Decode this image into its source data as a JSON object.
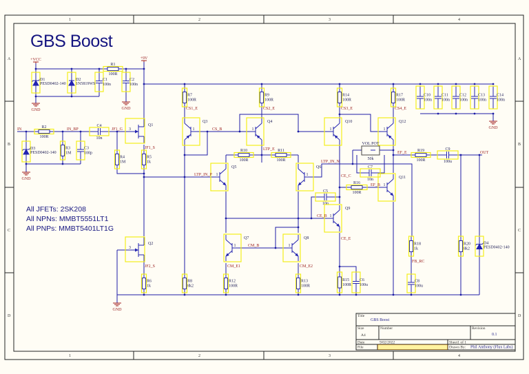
{
  "sheet": {
    "title": "GBS Boost",
    "columns": [
      "1",
      "2",
      "3",
      "4"
    ],
    "rows": [
      "A",
      "B",
      "C",
      "D"
    ]
  },
  "notes": [
    "All JFETs: 2SK208",
    "All NPNs: MMBT5551LT1",
    "All PNPs: MMBT5401LT1G"
  ],
  "components": {
    "R1": {
      "ref": "R1",
      "value": "100R"
    },
    "R2": {
      "ref": "R2",
      "value": "100R"
    },
    "R3": {
      "ref": "R3",
      "value": "1M"
    },
    "R4": {
      "ref": "R4",
      "value": "1M"
    },
    "R5": {
      "ref": "R5",
      "value": "1k"
    },
    "R6": {
      "ref": "R6",
      "value": "1k"
    },
    "R7": {
      "ref": "R7",
      "value": "100R"
    },
    "R8": {
      "ref": "R8",
      "value": "8k2"
    },
    "R9": {
      "ref": "R9",
      "value": "100R"
    },
    "R10": {
      "ref": "R10",
      "value": "100R"
    },
    "R11": {
      "ref": "R11",
      "value": "100R"
    },
    "R12": {
      "ref": "R12",
      "value": "100R"
    },
    "R13": {
      "ref": "R13",
      "value": "100R"
    },
    "R14": {
      "ref": "R14",
      "value": "100R"
    },
    "R15": {
      "ref": "R15",
      "value": "100R"
    },
    "R16": {
      "ref": "R16",
      "value": "100R"
    },
    "R17": {
      "ref": "R17",
      "value": "100R"
    },
    "R18": {
      "ref": "R18",
      "value": "1k"
    },
    "R19": {
      "ref": "R19",
      "value": "100R"
    },
    "R20": {
      "ref": "R20",
      "value": "8k2"
    },
    "C1": {
      "ref": "C1",
      "value": "100n"
    },
    "C2": {
      "ref": "C2",
      "value": "100n"
    },
    "C3": {
      "ref": "C3",
      "value": "100p"
    },
    "C4": {
      "ref": "C4",
      "value": "10n"
    },
    "C5": {
      "ref": "C5",
      "value": "10n"
    },
    "C6": {
      "ref": "C6",
      "value": "100u"
    },
    "C7": {
      "ref": "C7",
      "value": "10n"
    },
    "C8": {
      "ref": "C8",
      "value": "100u"
    },
    "C9": {
      "ref": "C9",
      "value": "100u"
    },
    "C10": {
      "ref": "C10",
      "value": "100n"
    },
    "C11": {
      "ref": "C11",
      "value": "100n"
    },
    "C12": {
      "ref": "C12",
      "value": "100n"
    },
    "C13": {
      "ref": "C13",
      "value": "100n"
    },
    "C14": {
      "ref": "C14",
      "value": "100n"
    },
    "D1": {
      "ref": "D1",
      "value": "PESD0402-140"
    },
    "D2": {
      "ref": "D2",
      "value": "1N5819WS"
    },
    "D3": {
      "ref": "D3",
      "value": "PESD0402-140"
    },
    "D4": {
      "ref": "D4",
      "value": "PESD0402-140"
    },
    "Q1": {
      "ref": "Q1"
    },
    "Q2": {
      "ref": "Q2"
    },
    "Q3": {
      "ref": "Q3"
    },
    "Q4": {
      "ref": "Q4"
    },
    "Q5": {
      "ref": "Q5"
    },
    "Q6": {
      "ref": "Q6"
    },
    "Q7": {
      "ref": "Q7"
    },
    "Q8": {
      "ref": "Q8"
    },
    "Q9": {
      "ref": "Q9"
    },
    "Q10": {
      "ref": "Q10"
    },
    "Q11": {
      "ref": "Q11"
    },
    "Q12": {
      "ref": "Q12"
    },
    "VOLPOT": {
      "ref": "VOL POT",
      "value": "50k"
    }
  },
  "pin_labels": {
    "base": "1",
    "gate": "3"
  },
  "nets": {
    "VCC": "+VCC",
    "V9": "+9V",
    "GND": "GND",
    "IN": "IN",
    "IN_BP": "IN_BP",
    "JF1_G": "JF1_G",
    "JF1_S": "JF1_S",
    "JF2_S": "JF2_S",
    "CS1_E": "CS1_E",
    "CS2_E": "CS2_E",
    "CS3_E": "CS3_E",
    "CS4_E": "CS4_E",
    "CS_B": "CS_B",
    "LTP_E": "LTP_E",
    "LTP_IN_P": "LTP_IN_P",
    "LTP_IN_N": "LTP_IN_N",
    "CE_C": "CE_C",
    "CE_B": "CE_B",
    "CE_E": "CE_E",
    "EF_B": "EF_B",
    "EF_E": "EF_E",
    "OUT": "OUT",
    "CM_B": "CM_B",
    "CM_E1": "CM_E1",
    "CM_E2": "CM_E2",
    "FB_RC": "FB_RC"
  },
  "title_block": {
    "title_label": "Title",
    "title": "GBS Boost",
    "size_label": "Size",
    "size": "A4",
    "number_label": "Number",
    "revision_label": "Revision",
    "revision": "0.1",
    "date_label": "Date",
    "date": "9/02/2022",
    "sheet": "Sheet1 of 1",
    "file_label": "File",
    "drawn_by_label": "Drawn By:",
    "drawn_by": "Phil Anthony (Flux Labs)"
  }
}
